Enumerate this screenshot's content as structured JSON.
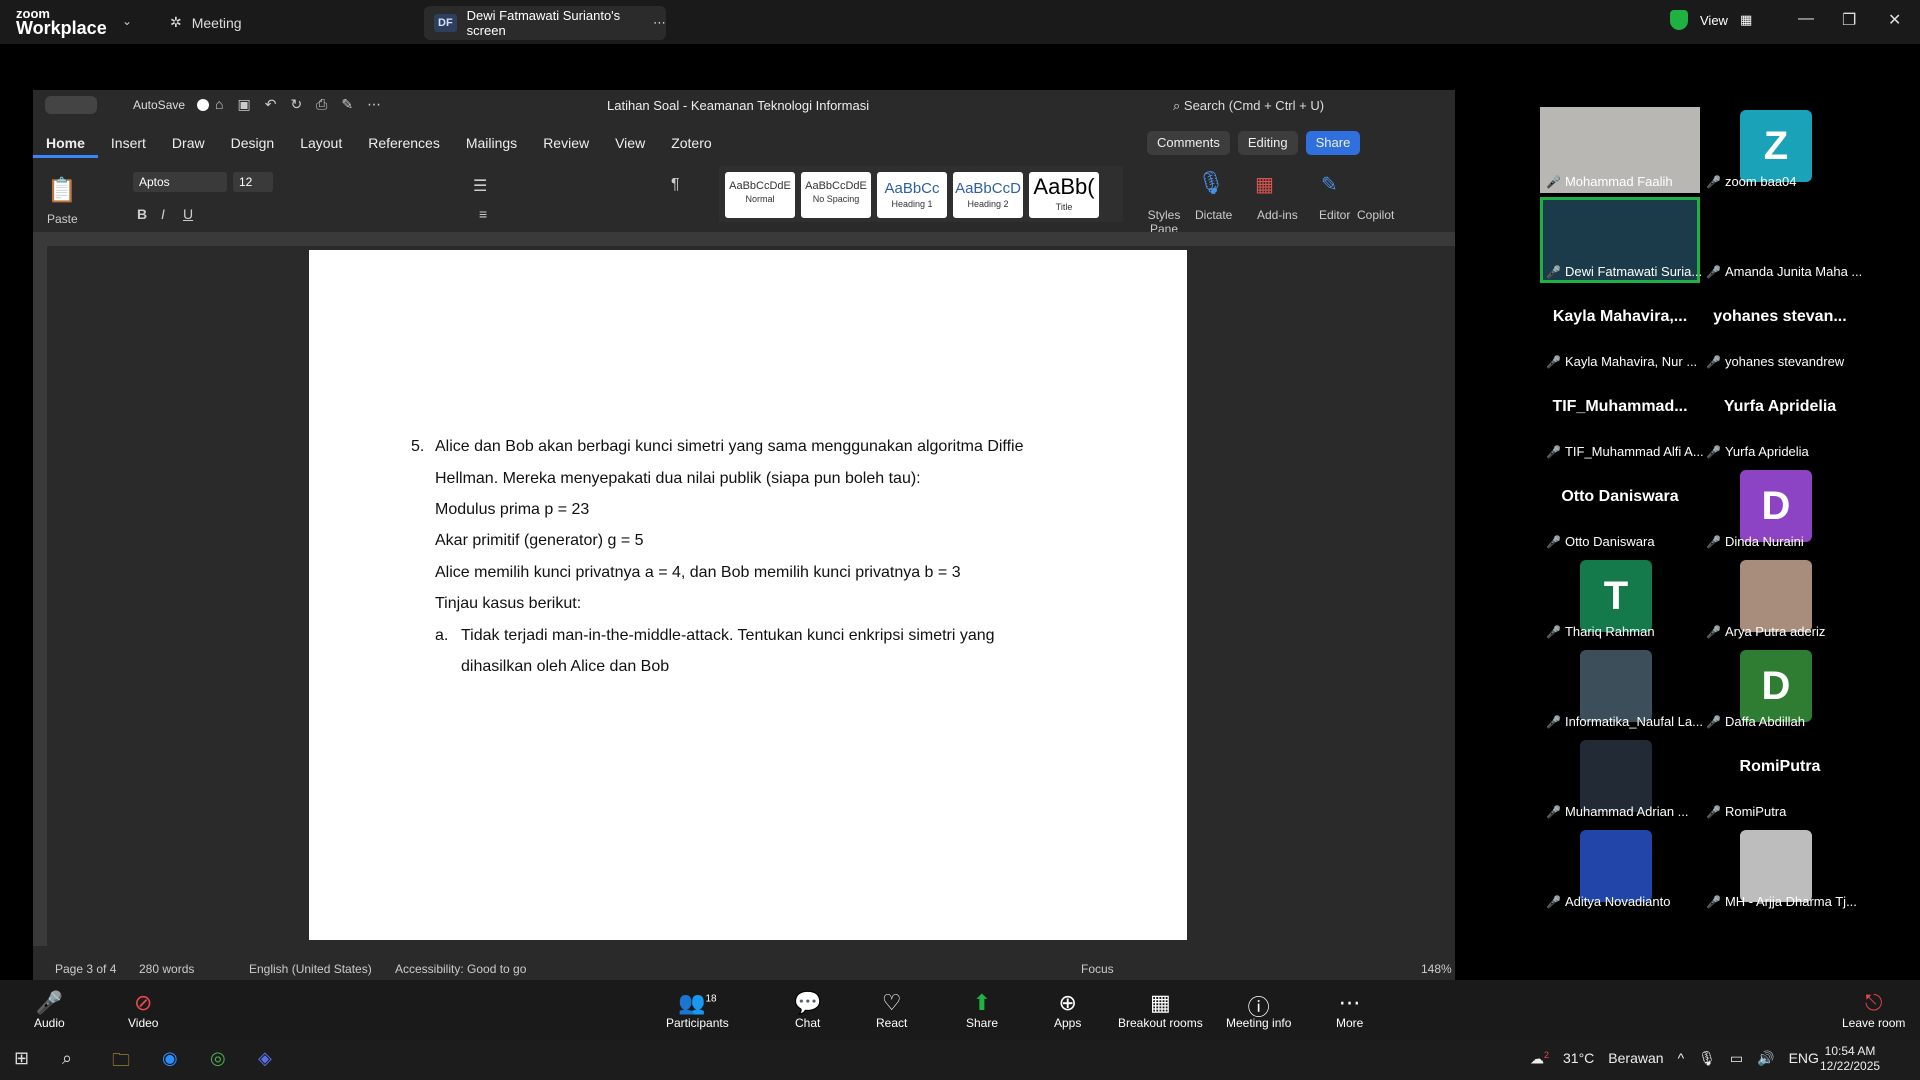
{
  "zoom": {
    "logo_top": "zoom",
    "logo_bottom": "Workplace",
    "meeting_label": "Meeting",
    "screen_badge": "DF",
    "screen_label": "Dewi Fatmawati Surianto's screen",
    "view_label": "View"
  },
  "word": {
    "autosave": "AutoSave",
    "doc_title": "Latihan Soal - Keamanan Teknologi Informasi",
    "search": "Search (Cmd + Ctrl + U)",
    "tabs": [
      "Home",
      "Insert",
      "Draw",
      "Design",
      "Layout",
      "References",
      "Mailings",
      "Review",
      "View",
      "Zotero"
    ],
    "comments": "Comments",
    "editing": "Editing",
    "share": "Share",
    "font": "Aptos",
    "size": "12",
    "paste": "Paste",
    "styles": [
      {
        "sample": "AaBbCcDdE",
        "name": "Normal"
      },
      {
        "sample": "AaBbCcDdE",
        "name": "No Spacing"
      },
      {
        "sample": "AaBbCc",
        "name": "Heading 1"
      },
      {
        "sample": "AaBbCcD",
        "name": "Heading 2"
      },
      {
        "sample": "AaBb(",
        "name": "Title"
      }
    ],
    "styles_pane": "Styles Pane",
    "dictate": "Dictate",
    "addins": "Add-ins",
    "editor": "Editor",
    "copilot": "Copilot",
    "status": {
      "page": "Page 3 of 4",
      "words": "280 words",
      "language": "English (United States)",
      "accessibility": "Accessibility: Good to go",
      "focus": "Focus",
      "zoom": "148%"
    }
  },
  "doc": {
    "number": "5.",
    "lines": [
      "Alice dan Bob akan berbagi kunci simetri yang sama menggunakan algoritma Diffie",
      "Hellman. Mereka menyepakati dua nilai publik (siapa pun boleh tau):",
      "Modulus prima p = 23",
      "Akar primitif (generator) g = 5",
      "Alice memilih kunci privatnya a = 4, dan Bob memilih kunci privatnya b = 3",
      "Tinjau kasus berikut:"
    ],
    "sub_letter": "a.",
    "sub_lines": [
      "Tidak  terjadi man-in-the-middle-attack. Tentukan  kunci  enkripsi  simetri  yang",
      "dihasilkan oleh Alice dan Bob"
    ]
  },
  "participants": [
    {
      "big": "",
      "label": "Mohammad Faalih",
      "kind": "video"
    },
    {
      "big": "Z",
      "label": "zoom baa04",
      "kind": "avatar",
      "color": "#1aa3b8"
    },
    {
      "big": "",
      "label": "Dewi Fatmawati Suria...",
      "kind": "video-active"
    },
    {
      "big": "",
      "label": "Amanda Junita Maha ...",
      "kind": "black"
    },
    {
      "big": "Kayla  Mahavira,...",
      "label": "Kayla Mahavira, Nur ...",
      "kind": "name"
    },
    {
      "big": "yohanes  stevan...",
      "label": "yohanes stevandrew",
      "kind": "name"
    },
    {
      "big": "TIF_Muhammad...",
      "label": "TIF_Muhammad Alfi A...",
      "kind": "name"
    },
    {
      "big": "Yurfa Apridelia",
      "label": "Yurfa Apridelia",
      "kind": "name"
    },
    {
      "big": "Otto Daniswara",
      "label": "Otto Daniswara",
      "kind": "name"
    },
    {
      "big": "D",
      "label": "Dinda Nuraini",
      "kind": "avatar",
      "color": "#8d44c4"
    },
    {
      "big": "T",
      "label": "Thariq Rahman",
      "kind": "avatar",
      "color": "#157a4b"
    },
    {
      "big": "",
      "label": "Arya Putra aderiz",
      "kind": "photo",
      "color": "#a98d7c"
    },
    {
      "big": "",
      "label": "Informatika_Naufal La...",
      "kind": "photo",
      "color": "#3c4e5a"
    },
    {
      "big": "D",
      "label": "Daffa Abdillah",
      "kind": "avatar",
      "color": "#2e7d32"
    },
    {
      "big": "",
      "label": "Muhammad Adrian ...",
      "kind": "photo",
      "color": "#222a36"
    },
    {
      "big": "RomiPutra",
      "label": "RomiPutra",
      "kind": "name"
    },
    {
      "big": "",
      "label": "Aditya Novadianto",
      "kind": "photo",
      "color": "#2145a8"
    },
    {
      "big": "",
      "label": "MH - Arjja Dharma Tj...",
      "kind": "photo",
      "color": "#bdbdbd"
    }
  ],
  "toolbar": {
    "audio": "Audio",
    "video": "Video",
    "participants": "Participants",
    "participant_count": "18",
    "chat": "Chat",
    "react": "React",
    "share": "Share",
    "apps": "Apps",
    "breakout": "Breakout rooms",
    "meeting_info": "Meeting info",
    "more": "More",
    "leave": "Leave room"
  },
  "taskbar": {
    "weather_temp": "31°C",
    "weather_text": "Berawan",
    "lang": "ENG",
    "time": "10:54 AM",
    "date": "12/22/2025",
    "weather_badge": "2",
    "notif_badge": "2"
  }
}
